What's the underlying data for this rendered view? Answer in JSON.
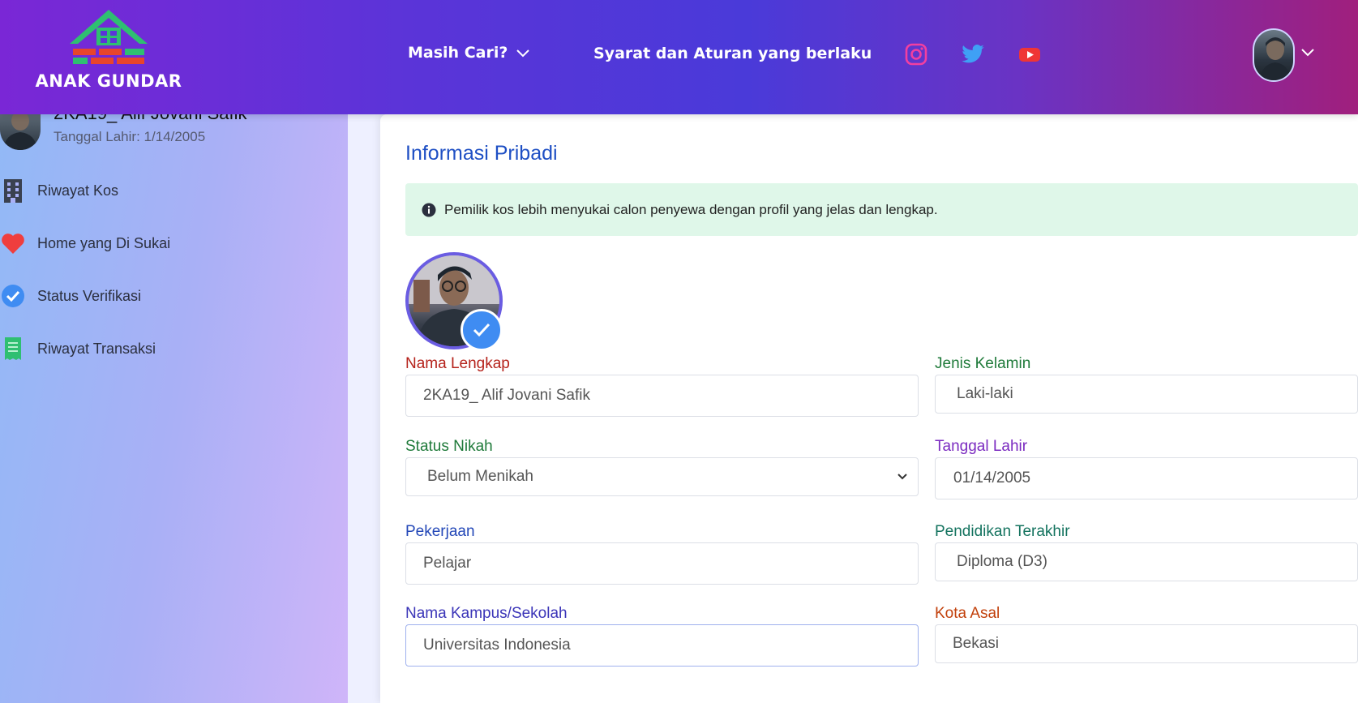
{
  "header": {
    "logo_text": "ANAK GUNDAR",
    "nav_masih": "Masih Cari?",
    "nav_syarat": "Syarat dan Aturan yang berlaku",
    "social": [
      "instagram-icon",
      "twitter-icon",
      "youtube-icon"
    ]
  },
  "sidebar": {
    "user_name": "2KA19_ Alif Jovani Safik",
    "user_dob": "Tanggal Lahir: 1/14/2005",
    "items": [
      {
        "label": "Riwayat Kos",
        "icon": "building-icon"
      },
      {
        "label": "Home yang Di Sukai",
        "icon": "heart-icon"
      },
      {
        "label": "Status Verifikasi",
        "icon": "check-circle-icon"
      },
      {
        "label": "Riwayat Transaksi",
        "icon": "receipt-icon"
      }
    ]
  },
  "main": {
    "title": "Informasi Pribadi",
    "alert": "Pemilik kos lebih menyukai calon penyewa dengan profil yang jelas dan lengkap.",
    "fields": {
      "nama_lengkap": {
        "label": "Nama Lengkap",
        "value": "2KA19_ Alif Jovani Safik"
      },
      "jenis_kelamin": {
        "label": "Jenis Kelamin",
        "value": "Laki-laki"
      },
      "status_nikah": {
        "label": "Status Nikah",
        "value": "Belum Menikah"
      },
      "tanggal_lahir": {
        "label": "Tanggal Lahir",
        "value": "01/14/2005"
      },
      "pekerjaan": {
        "label": "Pekerjaan",
        "value": "Pelajar"
      },
      "pendidikan": {
        "label": "Pendidikan Terakhir",
        "value": "Diploma (D3)"
      },
      "kampus": {
        "label": "Nama Kampus/Sekolah",
        "value": "Universitas Indonesia"
      },
      "kota_asal": {
        "label": "Kota Asal",
        "value": "Bekasi"
      }
    }
  },
  "colors": {
    "title": "#1e4fc4",
    "label_red": "#b5221b",
    "label_green": "#1f7a3a",
    "label_purple": "#7b2bc0",
    "label_blue": "#2448b8",
    "label_teal": "#14735f",
    "label_indigo": "#3b35b8",
    "label_orange": "#c2410c"
  }
}
